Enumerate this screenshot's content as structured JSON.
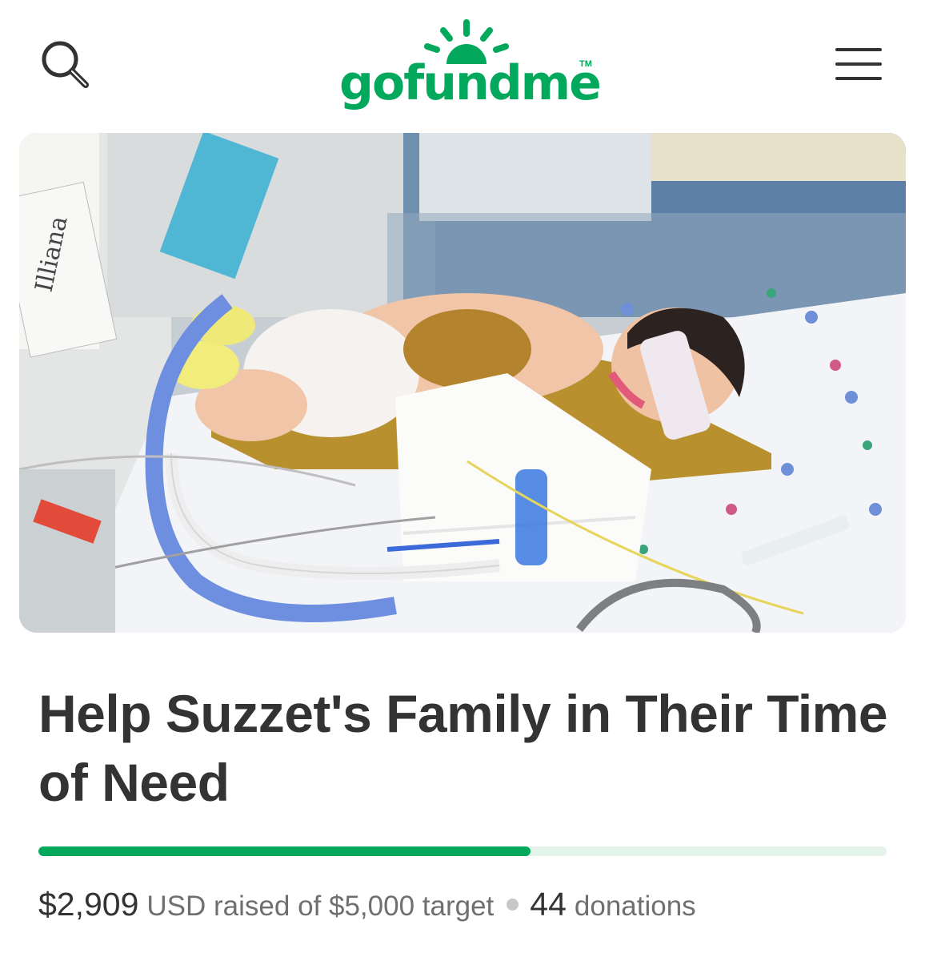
{
  "header": {
    "logo_text": "gofundme",
    "logo_tm": "TM",
    "brand_color": "#02a95c",
    "search_icon": "search-icon",
    "menu_icon": "hamburger-menu-icon"
  },
  "hero": {
    "photo_label": "Illiana"
  },
  "campaign": {
    "title": "Help Suzzet's Family in Their Time of Need",
    "raised": "$2,909",
    "raised_suffix": "USD raised of $5,000 target",
    "donations_count": "44",
    "donations_label": "donations",
    "progress": 0.58
  }
}
